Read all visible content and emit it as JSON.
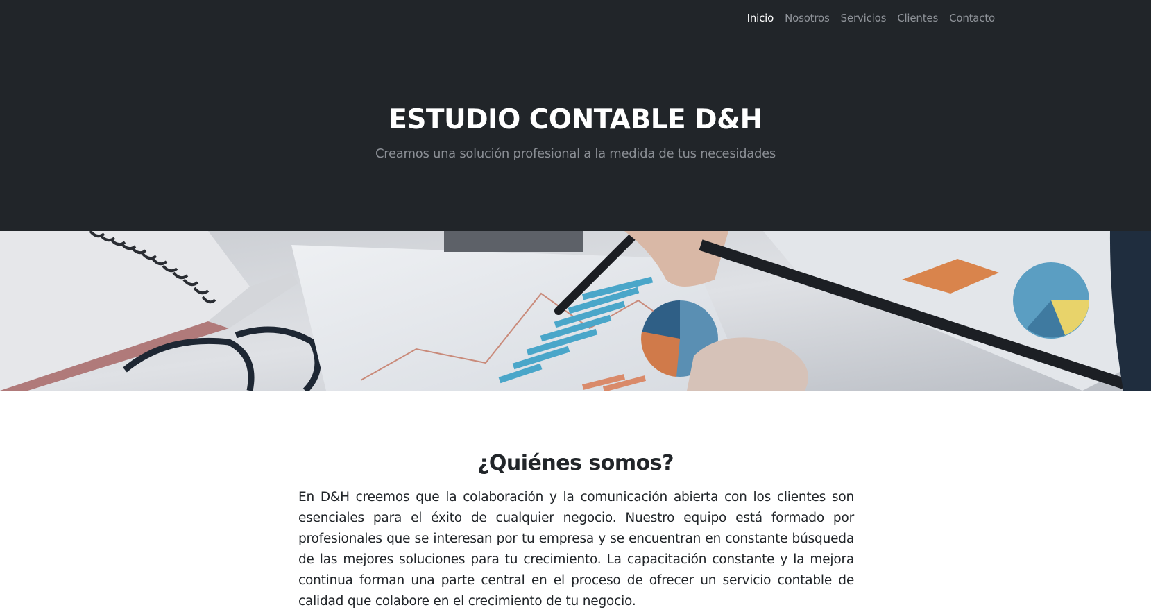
{
  "nav": {
    "items": [
      "Inicio",
      "Nosotros",
      "Servicios",
      "Clientes",
      "Contacto"
    ],
    "active": "Inicio"
  },
  "hero": {
    "title": "ESTUDIO CONTABLE D&H",
    "subtitle": "Creamos una solución profesional a la medida de tus necesidades"
  },
  "banner": {
    "image": "accounting-desk-photo"
  },
  "about": {
    "heading": "¿Quiénes somos?",
    "text": "En D&H creemos que la colaboración y la comunicación abierta con los clientes son esenciales para el éxito de cualquier negocio. Nuestro equipo está formado por profesionales que se interesan por tu empresa y se encuentran en constante búsqueda de las mejores soluciones para tu crecimiento. La capacitación constante y la mejora continua forman una parte central en el proceso de ofrecer un servicio contable de calidad que colabore en el crecimiento de tu negocio."
  },
  "colors": {
    "header_bg": "#212529",
    "nav_text": "#8f9399",
    "nav_active": "#ffffff",
    "body_text": "#212529"
  }
}
